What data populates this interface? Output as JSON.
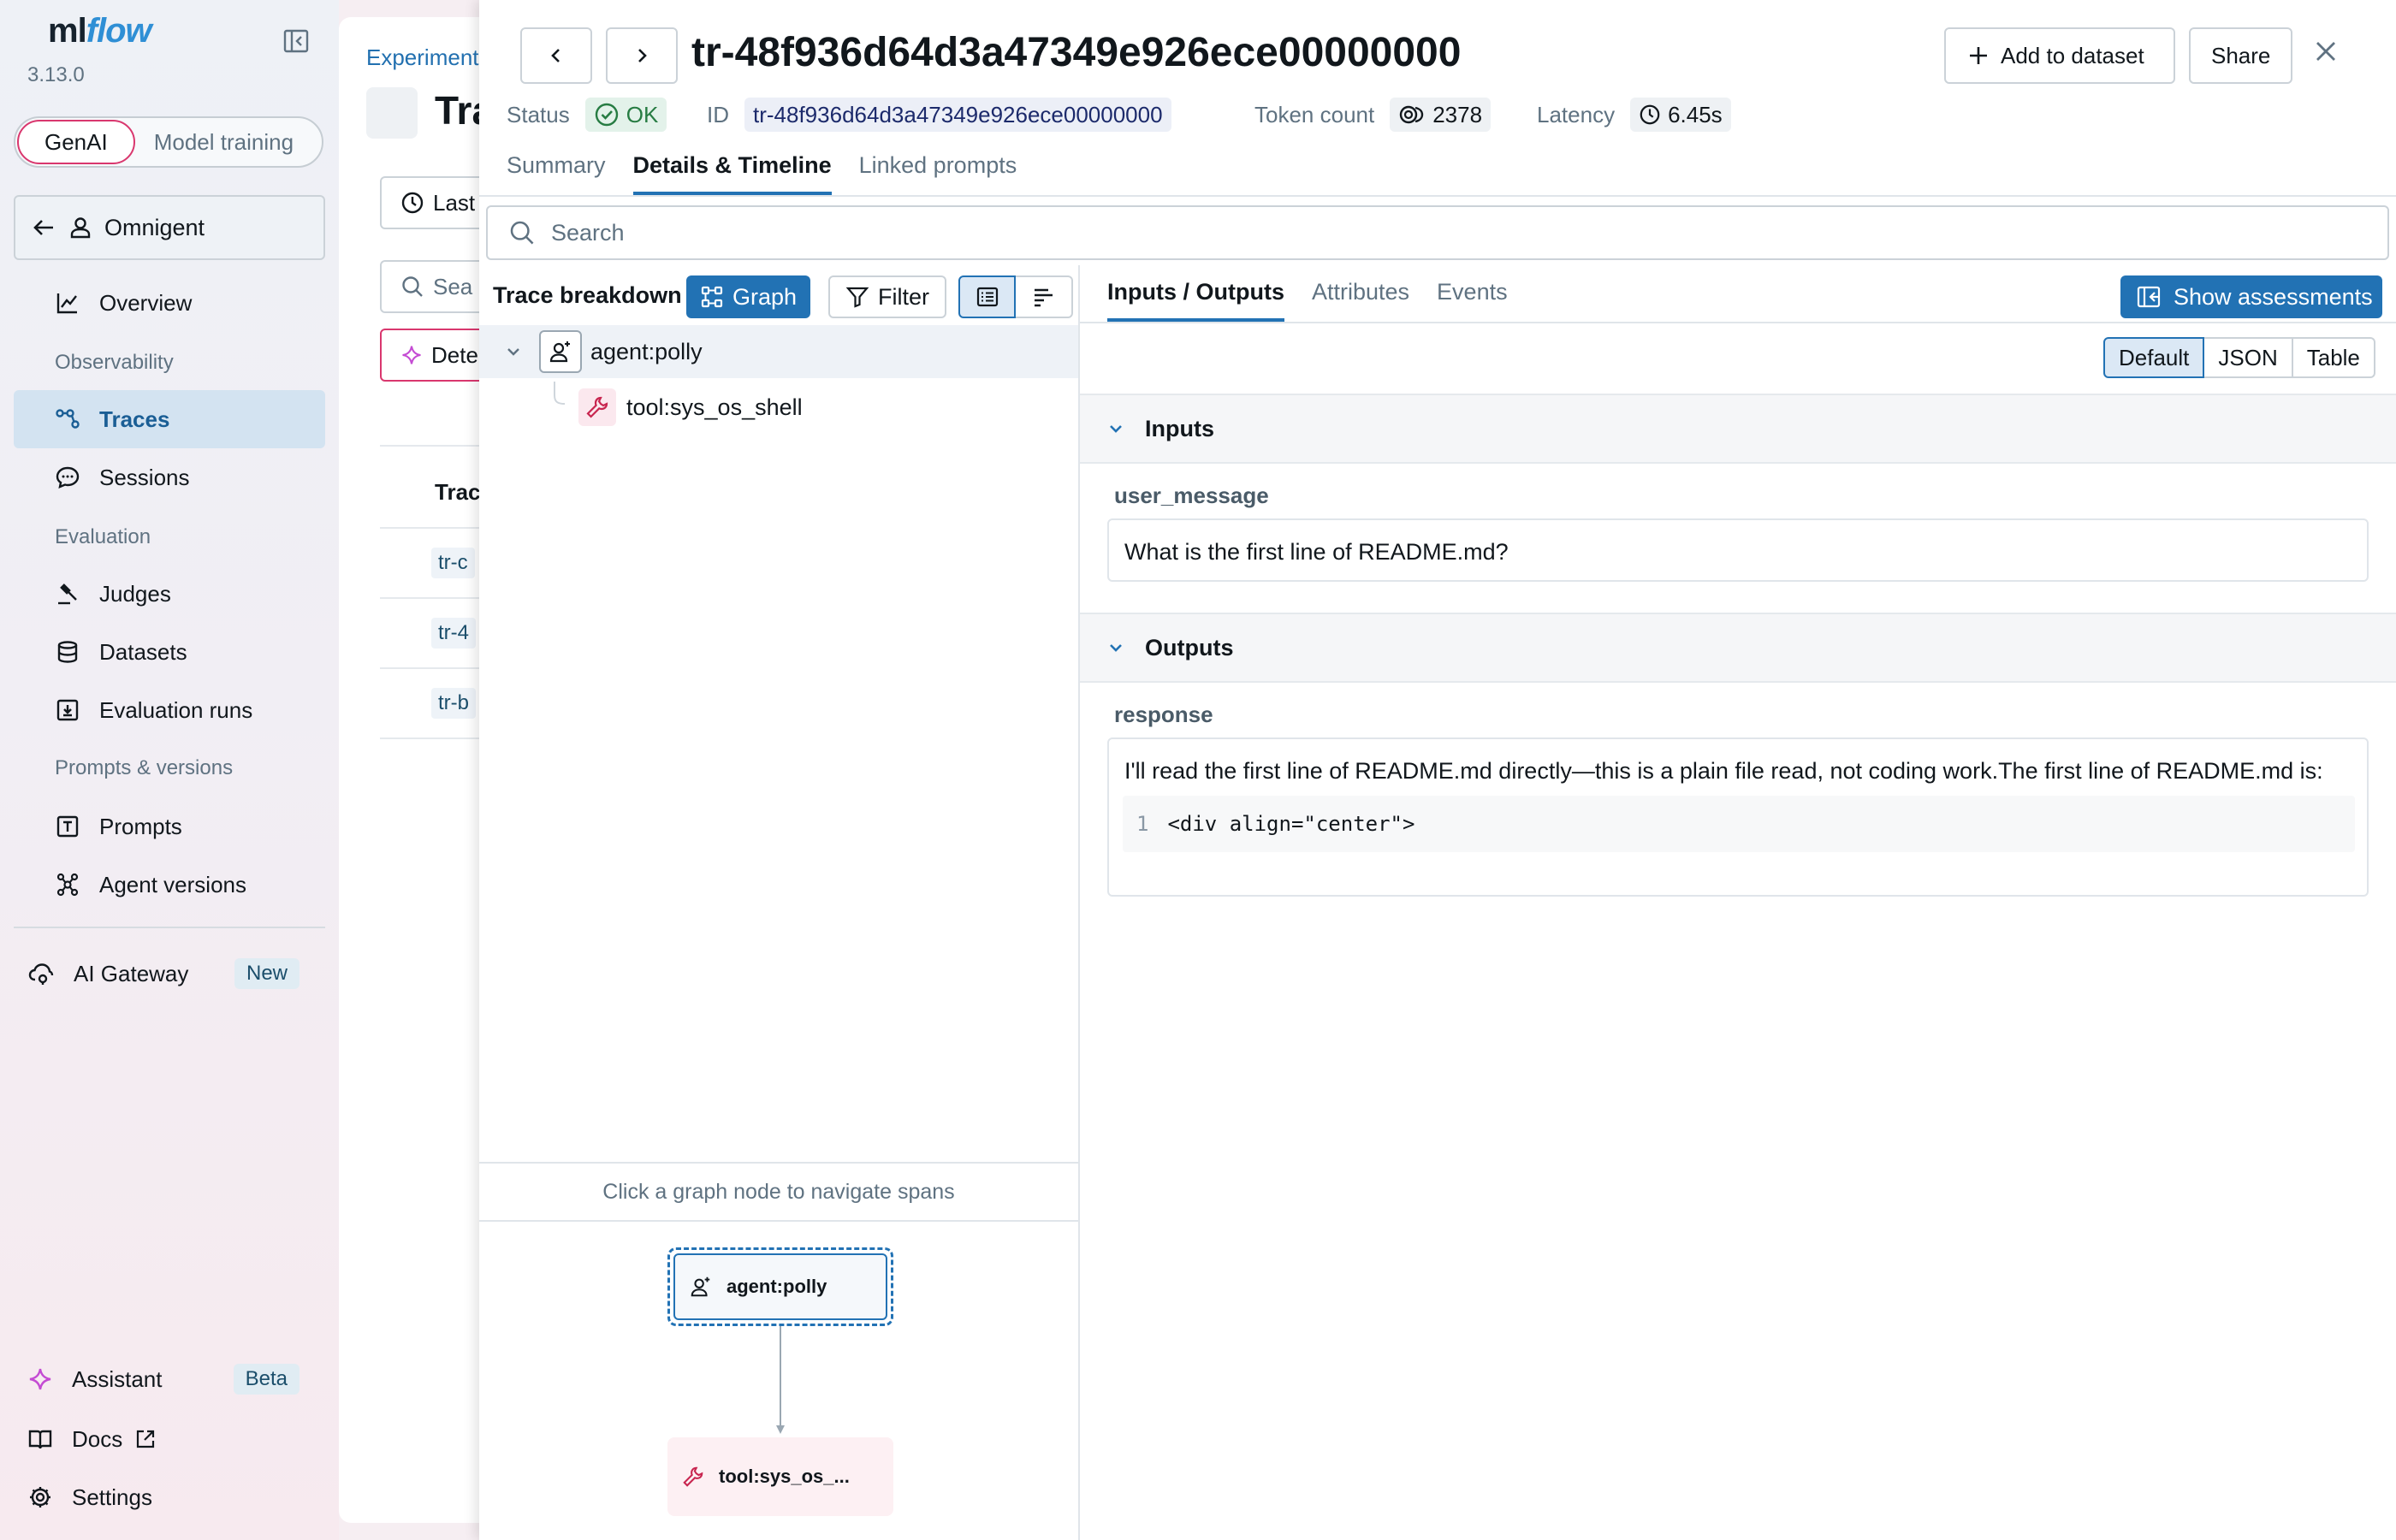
{
  "app": {
    "logo_ml": "ml",
    "logo_flow": "flow",
    "version": "3.13.0"
  },
  "mode_toggle": {
    "active": "GenAI",
    "inactive": "Model training"
  },
  "sidebar": {
    "workspace": "Omnigent",
    "overview": "Overview",
    "section_observability": "Observability",
    "traces": "Traces",
    "sessions": "Sessions",
    "section_evaluation": "Evaluation",
    "judges": "Judges",
    "datasets": "Datasets",
    "evaluation_runs": "Evaluation runs",
    "section_prompts": "Prompts & versions",
    "prompts": "Prompts",
    "agent_versions": "Agent versions",
    "ai_gateway": "AI Gateway",
    "ai_gateway_badge": "New",
    "assistant": "Assistant",
    "assistant_badge": "Beta",
    "docs": "Docs",
    "settings": "Settings"
  },
  "background": {
    "breadcrumb": "Experiment",
    "title": "Tra",
    "time_btn": "Last",
    "search": "Sea",
    "detect_btn": "Dete",
    "col_header": "Trac",
    "rows": [
      "tr-c",
      "tr-4",
      "tr-b"
    ]
  },
  "trace": {
    "id": "tr-48f936d64d3a47349e926ece00000000",
    "status_label": "Status",
    "status": "OK",
    "id_label": "ID",
    "token_label": "Token count",
    "token_count": "2378",
    "latency_label": "Latency",
    "latency": "6.45s",
    "add_to_dataset": "Add to dataset",
    "share": "Share"
  },
  "tabs": [
    "Summary",
    "Details & Timeline",
    "Linked prompts"
  ],
  "search_placeholder": "Search",
  "breakdown": {
    "title": "Trace breakdown",
    "graph_btn": "Graph",
    "filter_btn": "Filter",
    "spans": [
      {
        "name": "agent:polly",
        "type": "agent"
      },
      {
        "name": "tool:sys_os_shell",
        "type": "tool"
      }
    ],
    "graph_hint": "Click a graph node to navigate spans",
    "graph_nodes": [
      "agent:polly",
      "tool:sys_os_..."
    ]
  },
  "detail": {
    "tabs": [
      "Inputs / Outputs",
      "Attributes",
      "Events"
    ],
    "show_assessments": "Show assessments",
    "formats": [
      "Default",
      "JSON",
      "Table"
    ],
    "inputs_header": "Inputs",
    "input_key": "user_message",
    "input_value": "What is the first line of README.md?",
    "outputs_header": "Outputs",
    "output_key": "response",
    "output_value": "I'll read the first line of README.md directly—this is a plain file read, not coding work.The first line of README.md is:",
    "code_line_no": "1",
    "code_line": "<div align=\"center\">"
  },
  "colors": {
    "accent": "#2272b4",
    "genai_pink": "#d9376e",
    "ok_green": "#277c43",
    "tool_red": "#c8254f"
  }
}
